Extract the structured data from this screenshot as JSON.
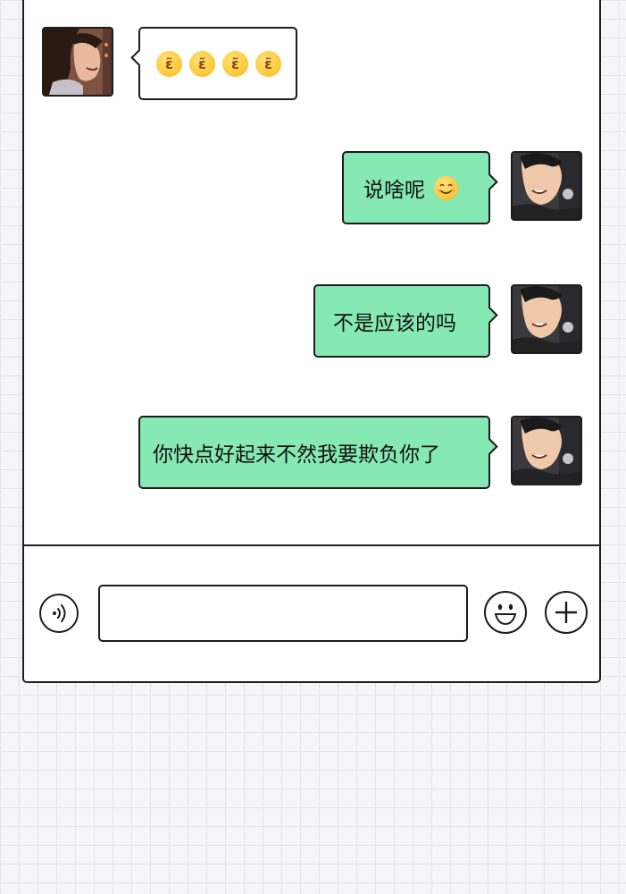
{
  "messages": [
    {
      "side": "left",
      "sender": "her",
      "text": "",
      "emojis": [
        "kiss-emoji",
        "kiss-emoji",
        "kiss-emoji",
        "kiss-emoji"
      ]
    },
    {
      "side": "right",
      "sender": "him",
      "text": "说啥呢",
      "emojis": [
        "smile-emoji"
      ]
    },
    {
      "side": "right",
      "sender": "him",
      "text": "不是应该的吗",
      "emojis": []
    },
    {
      "side": "right",
      "sender": "him",
      "text": "你快点好起来不然我要欺负你了",
      "emojis": []
    }
  ],
  "composer": {
    "input_value": "",
    "left_icon": "voice-icon",
    "right_icons": [
      "emoji-face-icon",
      "plus-icon"
    ]
  },
  "colors": {
    "bubble_outgoing": "#86e9b4",
    "bubble_incoming": "#ffffff",
    "outline": "#1c1c1c"
  }
}
